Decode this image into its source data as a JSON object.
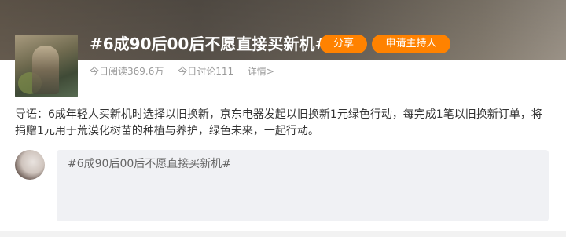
{
  "topic": {
    "title": "#6成90后00后不愿直接买新机#",
    "share_label": "分享",
    "apply_host_label": "申请主持人",
    "reads": "今日阅读369.6万",
    "discussions": "今日讨论111",
    "details": "详情>"
  },
  "intro": {
    "text": "导语：6成年轻人买新机时选择以旧换新，京东电器发起以旧换新1元绿色行动，每完成1笔以旧换新订单，将捐赠1元用于荒漠化树苗的种植与养护，绿色未来，一起行动。"
  },
  "composer": {
    "text": "#6成90后00后不愿直接买新机#"
  },
  "colors": {
    "accent": "#ff8200",
    "composer_bg": "#f0f1f4",
    "muted": "#999999"
  }
}
